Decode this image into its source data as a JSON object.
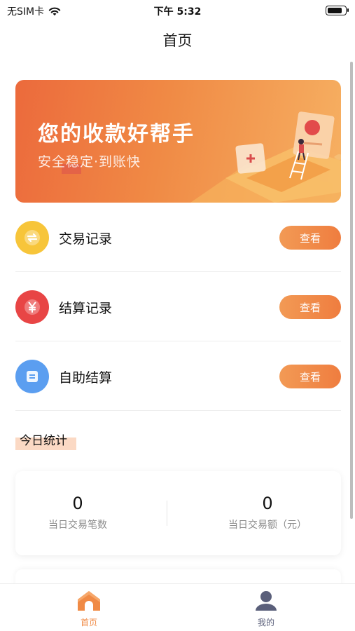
{
  "status_bar": {
    "carrier": "无SIM卡",
    "time": "下午 5:32",
    "battery_level": 0.85
  },
  "nav": {
    "title": "首页"
  },
  "banner": {
    "title": "您的收款好帮手",
    "subtitle": "安全稳定·到账快"
  },
  "menu": {
    "items": [
      {
        "label": "交易记录",
        "button": "查看",
        "icon": "exchange-icon",
        "color": "#f7c53a"
      },
      {
        "label": "结算记录",
        "button": "查看",
        "icon": "yuan-icon",
        "color": "#e84545"
      },
      {
        "label": "自助结算",
        "button": "查看",
        "icon": "document-icon",
        "color": "#5b9ef0"
      }
    ]
  },
  "stats": {
    "section_title": "今日统计",
    "items": [
      {
        "value": "0",
        "label": "当日交易笔数"
      },
      {
        "value": "0",
        "label": "当日交易额（元）"
      }
    ]
  },
  "tabs": [
    {
      "label": "首页",
      "icon": "home-icon",
      "active": true,
      "color": "#f08a45"
    },
    {
      "label": "我的",
      "icon": "user-icon",
      "active": false,
      "color": "#5a5f7a"
    }
  ]
}
